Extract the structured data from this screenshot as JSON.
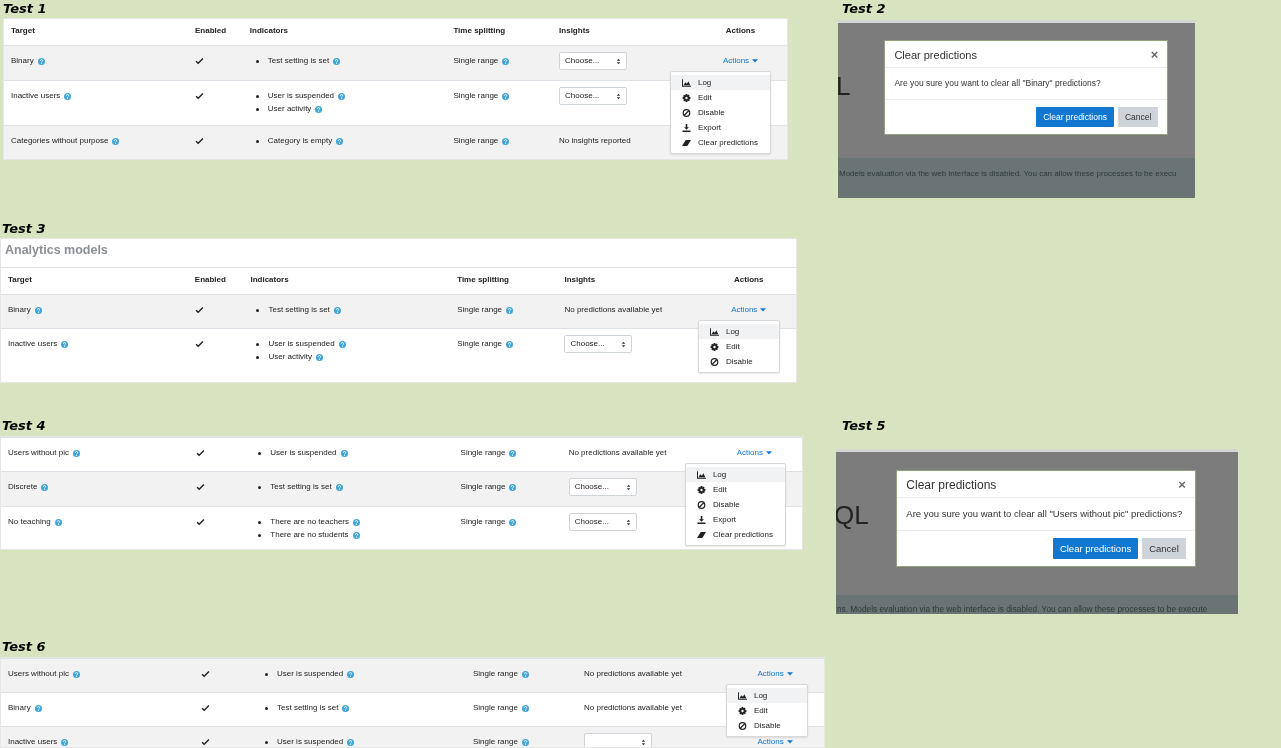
{
  "panels": [
    {
      "label": "Test 1",
      "kind": "table",
      "columns": [
        "Target",
        "Enabled",
        "Indicators",
        "Time splitting",
        "Insights",
        "Actions"
      ],
      "rows": [
        {
          "target": "Binary",
          "shaded": true,
          "enabled": true,
          "indicators": [
            "Test setting is set"
          ],
          "time_splitting": "Single range",
          "insights": {
            "kind": "select",
            "value": "Choose..."
          },
          "actions": "Actions",
          "menu": [
            {
              "label": "Log",
              "kind": "log",
              "selected": true
            },
            {
              "label": "Edit",
              "kind": "edit",
              "selected": false
            },
            {
              "label": "Disable",
              "kind": "disable",
              "selected": false
            },
            {
              "label": "Export",
              "kind": "export",
              "selected": false
            },
            {
              "label": "Clear predictions",
              "kind": "clear",
              "selected": false
            }
          ]
        },
        {
          "target": "Inactive users",
          "shaded": false,
          "enabled": true,
          "indicators": [
            "User is suspended",
            "User activity"
          ],
          "time_splitting": "Single range",
          "insights": {
            "kind": "select",
            "value": "Choose..."
          }
        },
        {
          "target": "Categories without purpose",
          "shaded": true,
          "enabled": true,
          "indicators": [
            "Category is empty"
          ],
          "time_splitting": "Single range",
          "insights": {
            "kind": "text",
            "text": "No insights reported"
          }
        }
      ]
    },
    {
      "label": "Test 2",
      "kind": "dialog",
      "backdrop_heading": "L",
      "notice": "Models evaluation via the web interface is disabled. You can allow these processes to be execu",
      "dialog": {
        "title": "Clear predictions",
        "close": "×",
        "message": "Are you sure you want to clear all \"Binary\" predictions?",
        "buttons": [
          {
            "label": "Clear predictions",
            "kind": "primary"
          },
          {
            "label": "Cancel",
            "kind": "secondary"
          }
        ]
      }
    },
    {
      "label": "Test 3",
      "kind": "table",
      "heading": "Analytics models",
      "columns": [
        "Target",
        "Enabled",
        "Indicators",
        "Time splitting",
        "Insights",
        "Actions"
      ],
      "rows": [
        {
          "target": "Binary",
          "shaded": true,
          "enabled": true,
          "indicators": [
            "Test setting is set"
          ],
          "time_splitting": "Single range",
          "insights": {
            "kind": "text",
            "text": "No predictions available yet"
          },
          "actions": "Actions",
          "menu": [
            {
              "label": "Log",
              "kind": "log",
              "selected": true
            },
            {
              "label": "Edit",
              "kind": "edit",
              "selected": false
            },
            {
              "label": "Disable",
              "kind": "disable",
              "selected": false
            }
          ]
        },
        {
          "target": "Inactive users",
          "shaded": false,
          "enabled": true,
          "indicators": [
            "User is suspended",
            "User activity"
          ],
          "time_splitting": "Single range",
          "insights": {
            "kind": "select",
            "value": "Choose..."
          }
        }
      ]
    },
    {
      "label": "Test 4",
      "kind": "table",
      "rows": [
        {
          "target": "Users without pic",
          "shaded": false,
          "enabled": true,
          "indicators": [
            "User is suspended"
          ],
          "time_splitting": "Single range",
          "insights": {
            "kind": "text",
            "text": "No predictions available yet"
          },
          "actions": "Actions",
          "menu": [
            {
              "label": "Log",
              "kind": "log",
              "selected": true
            },
            {
              "label": "Edit",
              "kind": "edit",
              "selected": false
            },
            {
              "label": "Disable",
              "kind": "disable",
              "selected": false
            },
            {
              "label": "Export",
              "kind": "export",
              "selected": false
            },
            {
              "label": "Clear predictions",
              "kind": "clear",
              "selected": false
            }
          ]
        },
        {
          "target": "Discrete",
          "shaded": true,
          "enabled": true,
          "indicators": [
            "Test setting is set"
          ],
          "time_splitting": "Single range",
          "insights": {
            "kind": "select",
            "value": "Choose..."
          }
        },
        {
          "target": "No teaching",
          "shaded": false,
          "enabled": true,
          "indicators": [
            "There are no teachers",
            "There are no students"
          ],
          "time_splitting": "Single range",
          "insights": {
            "kind": "select",
            "value": "Choose..."
          }
        }
      ]
    },
    {
      "label": "Test 5",
      "kind": "dialog",
      "backdrop_heading": "QL",
      "notice": "ns. Models evaluation via the web interface is disabled. You can allow these processes to be execute",
      "dialog": {
        "title": "Clear predictions",
        "close": "×",
        "message": "Are you sure you want to clear all \"Users without pic\" predictions?",
        "buttons": [
          {
            "label": "Clear predictions",
            "kind": "primary"
          },
          {
            "label": "Cancel",
            "kind": "secondary"
          }
        ]
      }
    },
    {
      "label": "Test 6",
      "kind": "table",
      "rows": [
        {
          "target": "Users without pic",
          "shaded": true,
          "enabled": true,
          "indicators": [
            "User is suspended"
          ],
          "time_splitting": "Single range",
          "insights": {
            "kind": "text",
            "text": "No predictions available yet"
          },
          "actions": "Actions",
          "menu": [
            {
              "label": "Log",
              "kind": "log",
              "selected": true
            },
            {
              "label": "Edit",
              "kind": "edit",
              "selected": false
            },
            {
              "label": "Disable",
              "kind": "disable",
              "selected": false
            }
          ]
        },
        {
          "target": "Binary",
          "shaded": false,
          "enabled": true,
          "indicators": [
            "Test setting is set"
          ],
          "time_splitting": "Single range",
          "insights": {
            "kind": "text",
            "text": "No predictions available yet"
          }
        },
        {
          "target": "Inactive users",
          "shaded": true,
          "enabled": true,
          "indicators": [
            "User is suspended"
          ],
          "time_splitting": "Single range",
          "insights": {
            "kind": "select"
          },
          "actions": "Actions"
        }
      ]
    }
  ]
}
